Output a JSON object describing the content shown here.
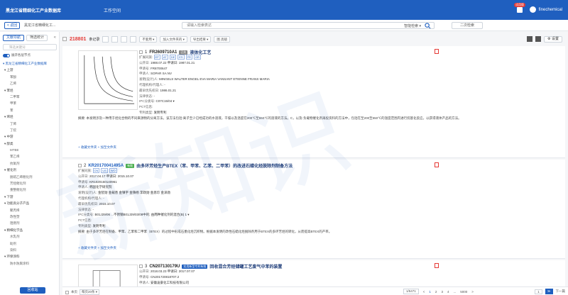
{
  "header": {
    "brand": "黑龙江省精细化工产业数据库",
    "home": "工作空间",
    "badge": "试用版",
    "user": "finechemical"
  },
  "tabbar": {
    "back_label": "< 返回",
    "tab_label": "黑龙江省精细化工...",
    "search_placeholder": "请输入检索表达",
    "scope": "智能检索 ▾",
    "two_label": "二次检索"
  },
  "sidebar": {
    "tab_tree": "文献导航",
    "tab_stats": "筛选统计",
    "filter_placeholder": "筛选关键词",
    "toggle_label": "展开各层节点",
    "tree": [
      {
        "level": 0,
        "label": "▾ 黑龙江省精细化工产业数据库"
      },
      {
        "level": 1,
        "label": "▾ 上游"
      },
      {
        "level": 2,
        "label": "苯酚"
      },
      {
        "level": 2,
        "label": "乙烯"
      },
      {
        "level": 1,
        "label": "▾ 苯烃"
      },
      {
        "level": 2,
        "label": "二甲苯"
      },
      {
        "level": 2,
        "label": "甲苯"
      },
      {
        "level": 2,
        "label": "苯"
      },
      {
        "level": 1,
        "label": "▾ 烯烃"
      },
      {
        "level": 2,
        "label": "丁烯"
      },
      {
        "level": 2,
        "label": "丁烷"
      },
      {
        "level": 1,
        "label": "▾ 中游"
      },
      {
        "level": 1,
        "label": "▾ 醇类"
      },
      {
        "level": 2,
        "label": "MTBE"
      },
      {
        "level": 2,
        "label": "苯乙烯"
      },
      {
        "level": 2,
        "label": "抗氧剂"
      },
      {
        "level": 1,
        "label": "▾ 催化剂"
      },
      {
        "level": 2,
        "label": "脱硫乙烯催化剂"
      },
      {
        "level": 2,
        "label": "芳烃催化剂"
      },
      {
        "level": 2,
        "label": "重整催化剂"
      },
      {
        "level": 1,
        "label": "▾ 下游"
      },
      {
        "level": 1,
        "label": "▾ 功能高分子产品"
      },
      {
        "level": 2,
        "label": "聚丙烯"
      },
      {
        "level": 2,
        "label": "改性塑"
      },
      {
        "level": 2,
        "label": "阻燃剂"
      },
      {
        "level": 1,
        "label": "▾ 精细化学品"
      },
      {
        "level": 2,
        "label": "水乳剂"
      },
      {
        "level": 2,
        "label": "助剂"
      },
      {
        "level": 2,
        "label": "染料"
      },
      {
        "level": 1,
        "label": "▾ 环保涂料"
      },
      {
        "level": 2,
        "label": "防水防腐涂料"
      }
    ],
    "bottom_button": "回收站"
  },
  "toolbar": {
    "count": "218801",
    "count_suffix": "条记录",
    "sort_label": "不套用 ▾",
    "collect_label": "加入文件夹的 ▾",
    "export_label": "导出结果 ▾",
    "analyze_label": "图 高级",
    "settings_label": "⚙ 设置"
  },
  "results": [
    {
      "index": "1",
      "pn": "FR2609710A1",
      "tag": "已失",
      "title": "液体化工艺",
      "rows": [
        {
          "label": "扩展同族: ",
          "chips": [
            "EP",
            "AT",
            "DE",
            "ES",
            "FR",
            "GR"
          ]
        },
        {
          "label": "公开日: ",
          "value": "1988.07.22  申请日: 1987.01.21"
        },
        {
          "label": "申请号: ",
          "value": "FR8700647"
        },
        {
          "label": "申请人: ",
          "value": "SOPAR SA NV"
        },
        {
          "label": "发明(设计)人: ",
          "value": "MINGELS WALTER  ENGEL EVA MARIA  VANSANT ETIENNE FRANS MARIA"
        },
        {
          "label": "代理机构/代理人: ",
          "value": "-"
        },
        {
          "label": "最早优先权日: ",
          "value": "1986.01.21"
        },
        {
          "label": "法律状态: ",
          "value": "-"
        },
        {
          "label": "IPC分类号: ",
          "value": "C07C15/04  ▾"
        },
        {
          "label": "PCT信息: ",
          "value": ""
        },
        {
          "label": "专利类型: ",
          "value": "发明专利"
        }
      ],
      "abstract": "摘要: 本发明涉及一种用于烃化合物的不同来源物的分离方法，该方法包括:离子至少已经成功的水溶液，干燥以及温度在200℃至550℃的溶液的方法。C，以及-负载物催化剂再投资料的方法中，包括在至200至550℃的温度范围内进行烷基化反应，以获得液体产品的方法。",
      "foot": "+ 收藏文件夹  + 加至文件夹"
    },
    {
      "index": "2",
      "pn": "KR20170041495A",
      "tag": "有效",
      "title": "由多环芳烃生产BTEX（苯、甲苯、乙苯、二甲苯）的改进石蜡化烃脱除剂制备方法",
      "rows": [
        {
          "label": "扩展同族: ",
          "chips": [
            "CN",
            "US",
            "WO"
          ]
        },
        {
          "label": "公开日: ",
          "value": "2017.04.17  申请日: 2015.10.07"
        },
        {
          "label": "申请号: ",
          "value": "KR1020150140961"
        },
        {
          "label": "申请人: ",
          "value": "韩国化学研究院"
        },
        {
          "label": "发明(设计)人: ",
          "value": "金智勋  金载善  金镇宇  金镇杨  李政勋  金恩珍  金泽勋"
        },
        {
          "label": "代理机构/代理人: ",
          "value": "-"
        },
        {
          "label": "最早优先权日: ",
          "value": "2015.10.07"
        },
        {
          "label": "法律状态: ",
          "value": "-"
        },
        {
          "label": "IPC分类号: ",
          "value": "B01J29/06 ...不锈钢B01J29/03/08中的; 由两种催化剂的混合(B) 1 ▾"
        },
        {
          "label": "PCT信息: ",
          "value": ""
        },
        {
          "label": "专利类型: ",
          "value": "发明专利"
        }
      ],
      "abstract": "摘要: 由于多环芳烃在制备、甲苯、乙苯和二甲苯（BTEX）的过程中形成石墨化烃沉积物。根据本发明的改性石蜡化烃脱除剂用于BTEX的多环芳烃的转化，从而提高BTEX的产率。",
      "foot": "+ 收藏文件夹  + 加至文件夹"
    },
    {
      "index": "3",
      "pn": "CN207130179U",
      "tag": "实用新型专利有效",
      "title": "回收混合芳烃储罐工艺废气中苯的装置",
      "rows": [
        {
          "label": "公开日: ",
          "value": "2018.03.23  申请日: 2017.07.07"
        },
        {
          "label": "申请号: ",
          "value": "CN201720818707.2"
        },
        {
          "label": "申请人: ",
          "value": "安徽凌豪化工科技有限公司"
        }
      ],
      "abstract": "",
      "foot": ""
    }
  ],
  "pagebar": {
    "select_label": "本页",
    "per_page": "每页20条 ▾",
    "total": "1/5471",
    "pages": [
      "<",
      "1",
      "2",
      "3",
      "4",
      "...",
      "5000",
      ">"
    ],
    "goto": "1",
    "next_label": "下一篇"
  }
}
